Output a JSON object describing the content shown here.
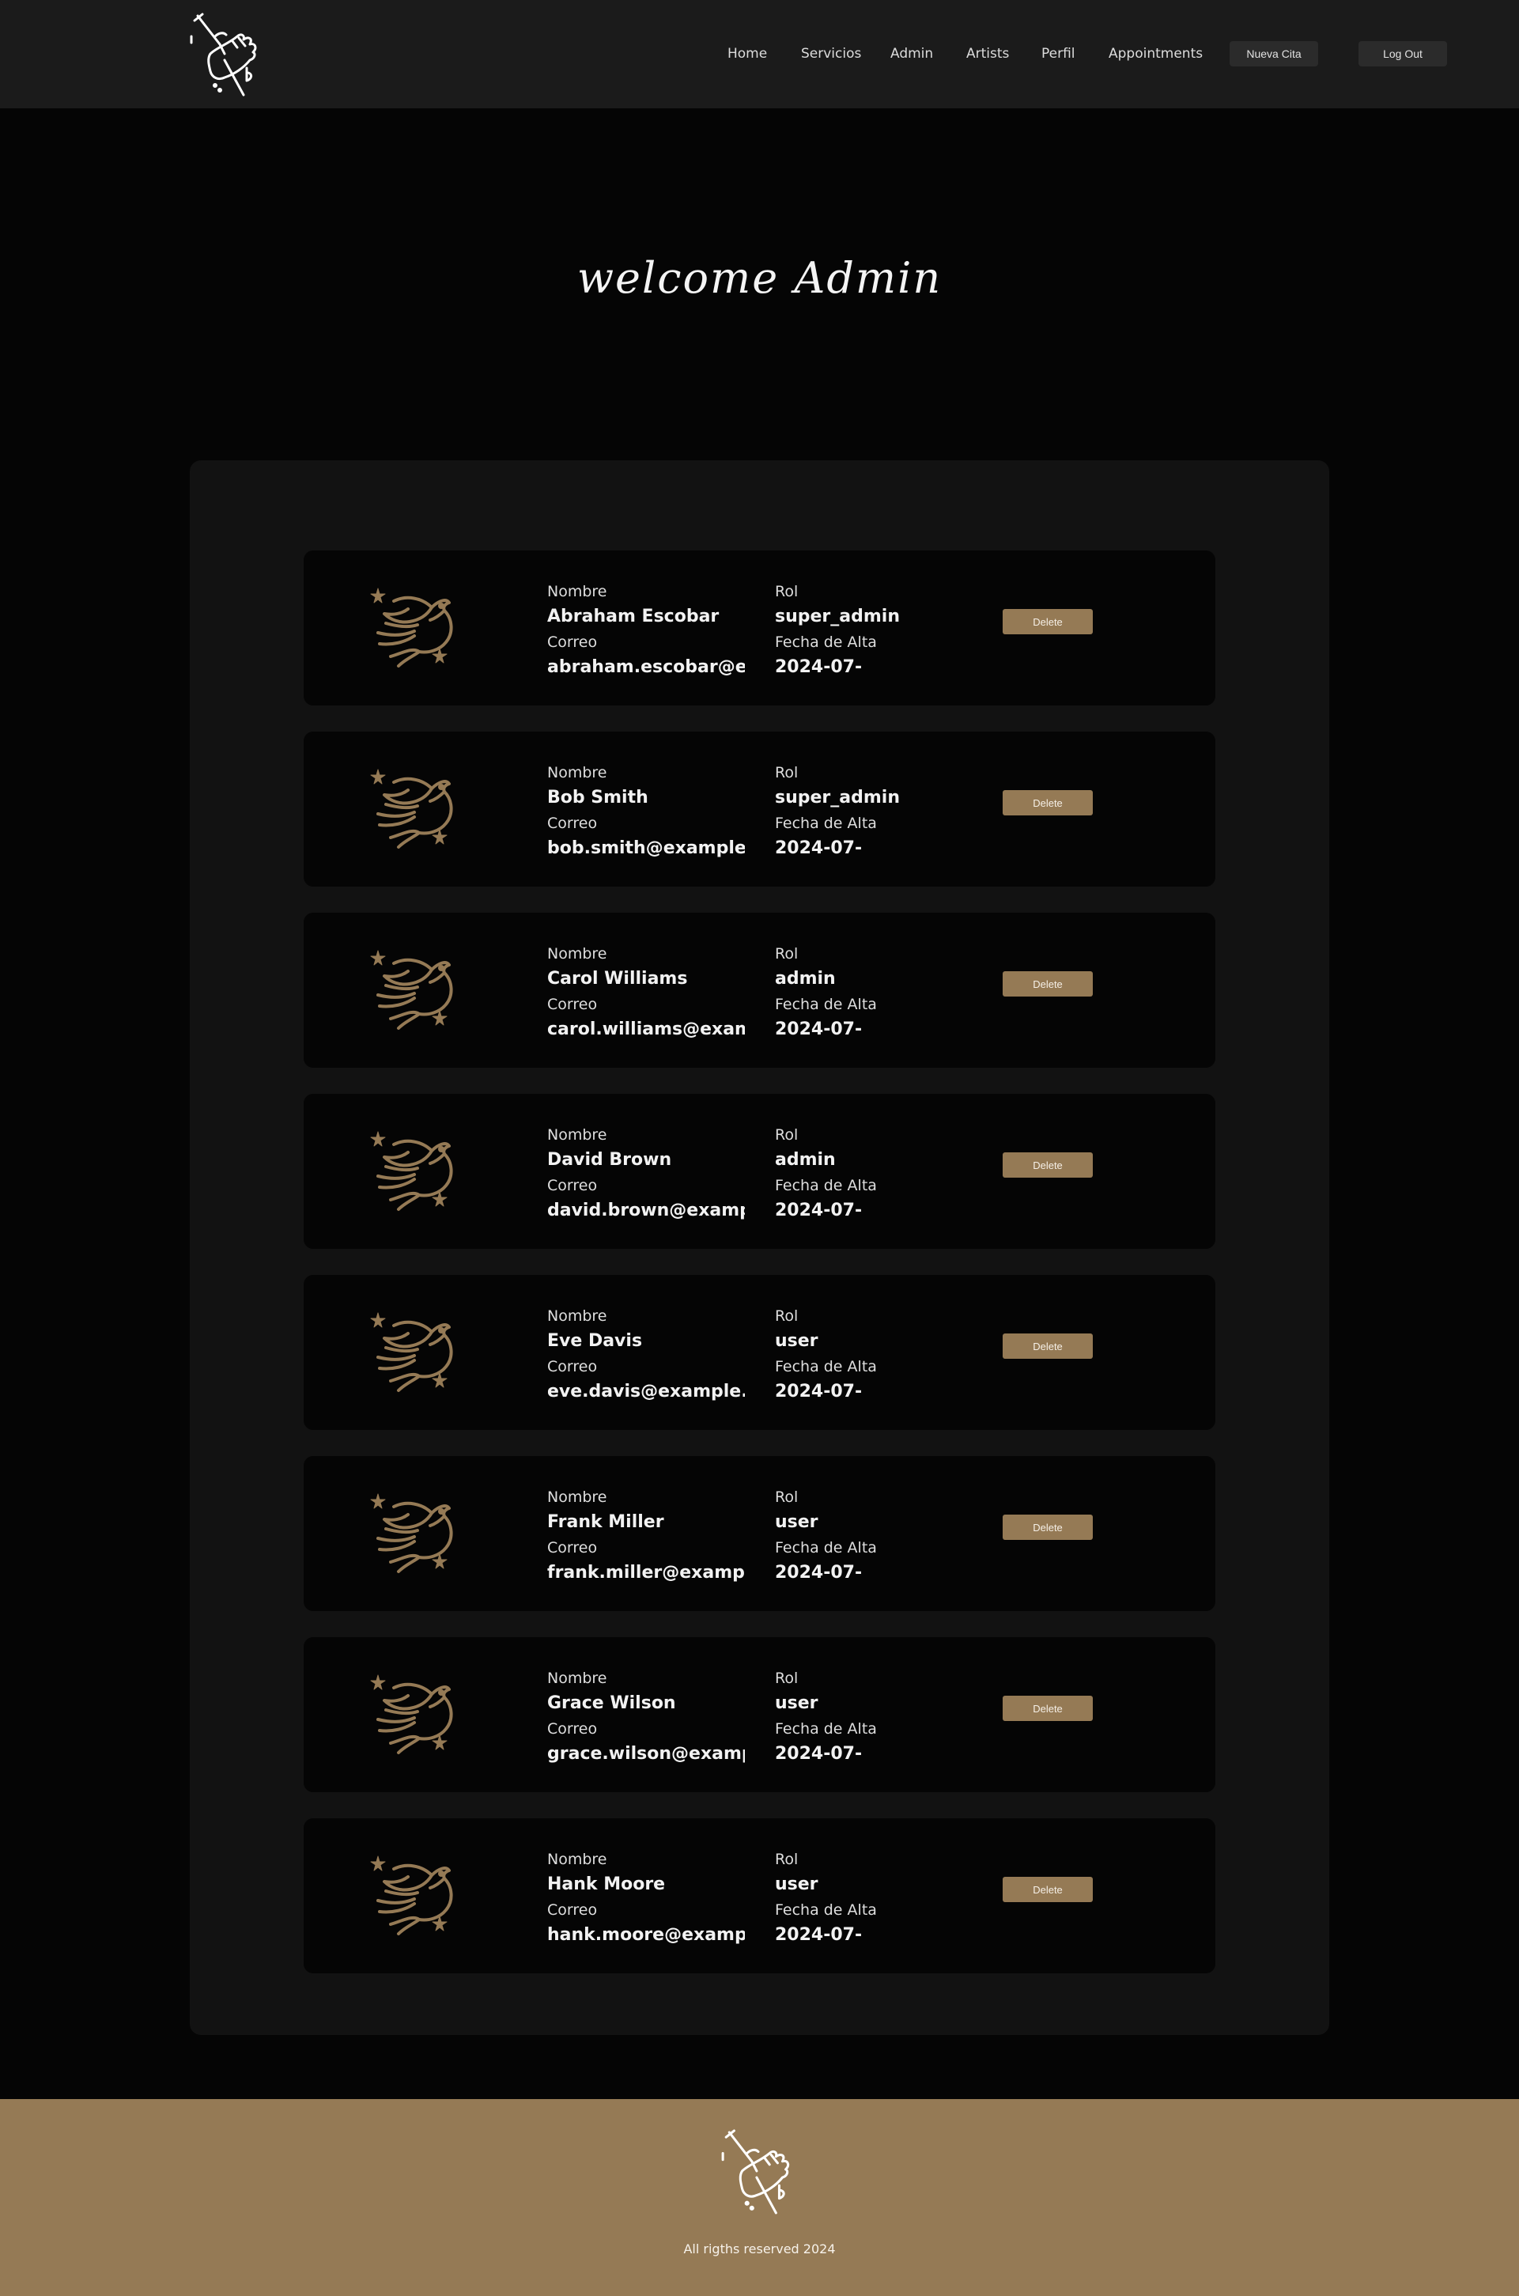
{
  "header": {
    "logo_icon": "dagger-hand-logo-icon",
    "nav": [
      "Home",
      "Servicios",
      "Admin",
      "Artists",
      "Perfil",
      "Appointments"
    ],
    "new_appointment_label": "Nueva Cita",
    "logout_label": "Log Out"
  },
  "welcome": "welcome Admin",
  "users_panel": {
    "avatar_icon": "swallow-stars-icon",
    "accent_color": "#957a55",
    "labels": {
      "name": "Nombre",
      "email": "Correo",
      "role": "Rol",
      "signup": "Fecha de Alta",
      "delete": "Delete"
    },
    "users": [
      {
        "name": "Abraham Escobar",
        "email": "abraham.escobar@exar",
        "role": "super_admin",
        "signup": "2024-07-"
      },
      {
        "name": "Bob Smith",
        "email": "bob.smith@example.co",
        "role": "super_admin",
        "signup": "2024-07-"
      },
      {
        "name": "Carol Williams",
        "email": "carol.williams@exampl",
        "role": "admin",
        "signup": "2024-07-"
      },
      {
        "name": "David Brown",
        "email": "david.brown@example.",
        "role": "admin",
        "signup": "2024-07-"
      },
      {
        "name": "Eve Davis",
        "email": "eve.davis@example.cor",
        "role": "user",
        "signup": "2024-07-"
      },
      {
        "name": "Frank Miller",
        "email": "frank.miller@example.c",
        "role": "user",
        "signup": "2024-07-"
      },
      {
        "name": "Grace Wilson",
        "email": "grace.wilson@example.",
        "role": "user",
        "signup": "2024-07-"
      },
      {
        "name": "Hank Moore",
        "email": "hank.moore@example.",
        "role": "user",
        "signup": "2024-07-"
      }
    ]
  },
  "footer": {
    "logo_icon": "dagger-hand-logo-icon",
    "background": "#957a55",
    "text": "All rigths reserved 2024"
  }
}
